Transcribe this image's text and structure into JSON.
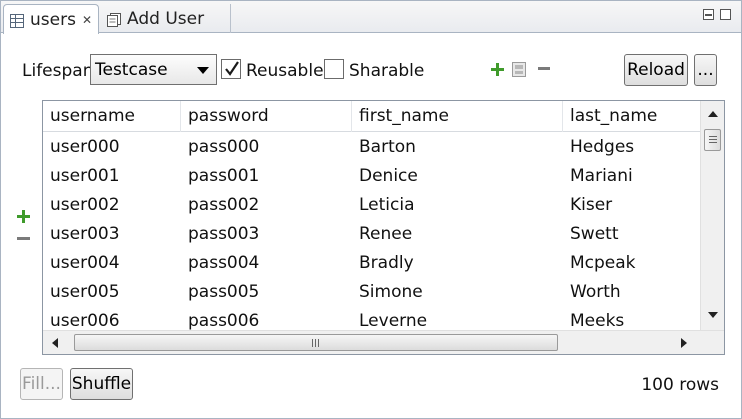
{
  "tabs": [
    {
      "label": "users",
      "active": true,
      "icon": "table-icon"
    },
    {
      "label": "Add User",
      "active": false,
      "icon": "document-icon"
    }
  ],
  "toolbar": {
    "lifespan_label": "Lifespan",
    "lifespan_value": "Testcase",
    "reusable_label": "Reusable",
    "reusable_checked": true,
    "sharable_label": "Sharable",
    "sharable_checked": false,
    "reload_label": "Reload",
    "more_label": "..."
  },
  "table": {
    "columns": [
      "username",
      "password",
      "first_name",
      "last_name"
    ],
    "rows": [
      [
        "user000",
        "pass000",
        "Barton",
        "Hedges"
      ],
      [
        "user001",
        "pass001",
        "Denice",
        "Mariani"
      ],
      [
        "user002",
        "pass002",
        "Leticia",
        "Kiser"
      ],
      [
        "user003",
        "pass003",
        "Renee",
        "Swett"
      ],
      [
        "user004",
        "pass004",
        "Bradly",
        "Mcpeak"
      ],
      [
        "user005",
        "pass005",
        "Simone",
        "Worth"
      ],
      [
        "user006",
        "pass006",
        "Leverne",
        "Meeks"
      ]
    ]
  },
  "footer": {
    "fill_label": "Fill...",
    "shuffle_label": "Shuffle",
    "row_count": "100 rows"
  },
  "colors": {
    "accent_green": "#3f9b2b",
    "border": "#a9b4c2"
  }
}
